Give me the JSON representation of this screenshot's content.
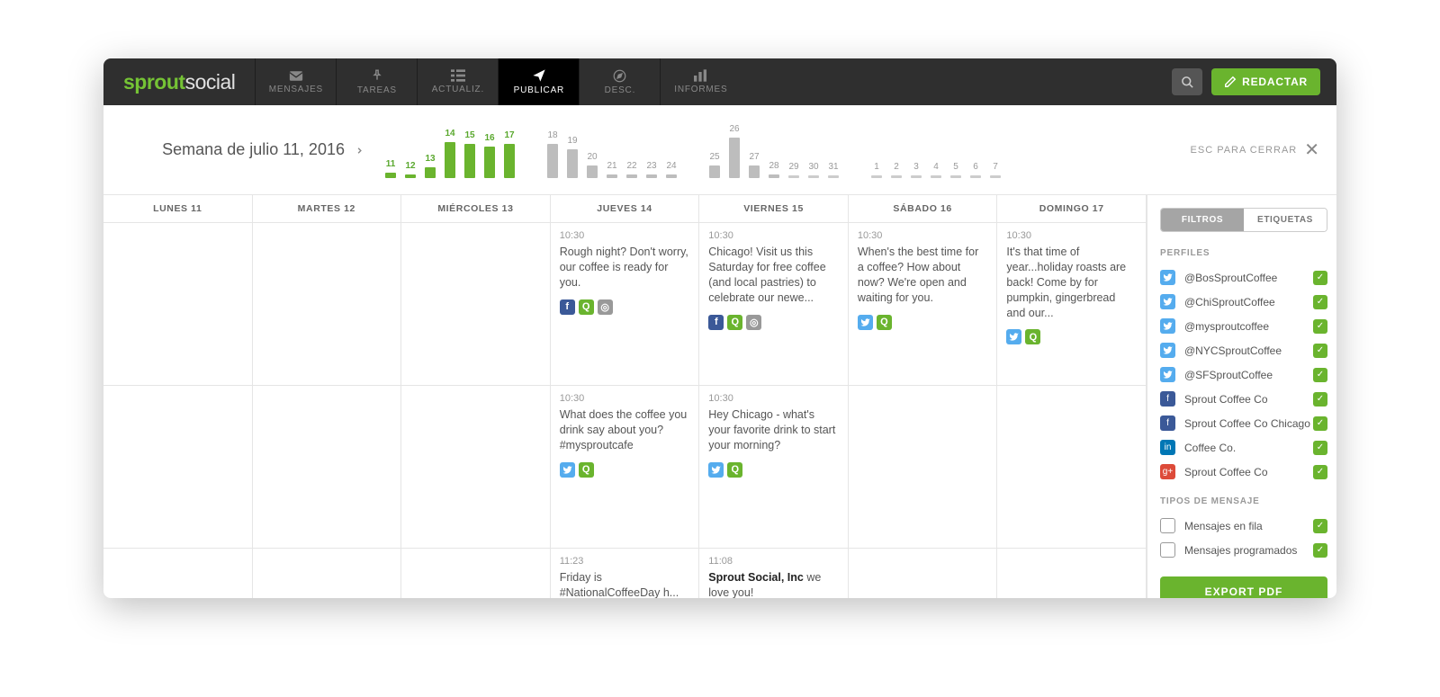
{
  "brand": {
    "part1": "sprout",
    "part2": "social"
  },
  "nav": [
    {
      "label": "MENSAJES",
      "icon": "mail"
    },
    {
      "label": "TAREAS",
      "icon": "pin"
    },
    {
      "label": "ACTUALIZ.",
      "icon": "feed"
    },
    {
      "label": "PUBLICAR",
      "icon": "send",
      "active": true
    },
    {
      "label": "DESC.",
      "icon": "compass"
    },
    {
      "label": "INFORMES",
      "icon": "bars"
    }
  ],
  "compose_label": "REDACTAR",
  "week_title": "Semana de julio 11, 2016",
  "close_label": "ESC PARA CERRAR",
  "chart_data": {
    "type": "bar",
    "title": "",
    "xlabel": "",
    "ylabel": "",
    "ylim": [
      0,
      50
    ],
    "groups": [
      {
        "name": "current_week",
        "color": "#6ab42e",
        "categories": [
          "11",
          "12",
          "13",
          "14",
          "15",
          "16",
          "17"
        ],
        "values": [
          6,
          4,
          12,
          40,
          38,
          35,
          38
        ]
      },
      {
        "name": "next_week",
        "color": "#bdbdbd",
        "categories": [
          "18",
          "19",
          "20",
          "21",
          "22",
          "23",
          "24"
        ],
        "values": [
          38,
          32,
          14,
          4,
          4,
          4,
          4
        ]
      },
      {
        "name": "week_after",
        "color": "#bdbdbd",
        "categories": [
          "25",
          "26",
          "27",
          "28",
          "29",
          "30",
          "31"
        ],
        "values": [
          14,
          45,
          14,
          4,
          3,
          3,
          3
        ]
      },
      {
        "name": "future",
        "color": "#cccccc",
        "categories": [
          "1",
          "2",
          "3",
          "4",
          "5",
          "6",
          "7"
        ],
        "values": [
          2,
          2,
          2,
          2,
          2,
          2,
          2
        ]
      }
    ]
  },
  "day_headers": [
    "LUNES 11",
    "MARTES 12",
    "MIÉRCOLES 13",
    "JUEVES 14",
    "VIERNES 15",
    "SÁBADO 16",
    "DOMINGO 17"
  ],
  "rows": [
    {
      "cells": [
        null,
        null,
        null,
        {
          "time": "10:30",
          "msg": "Rough night? Don't worry, our coffee is ready for you.",
          "icons": [
            "fb",
            "qq",
            "ig"
          ]
        },
        {
          "time": "10:30",
          "msg": "Chicago! Visit us this Saturday for free coffee (and local pastries) to celebrate our newe...",
          "icons": [
            "fb",
            "qq",
            "ig"
          ]
        },
        {
          "time": "10:30",
          "msg": "When's the best time for a coffee? How about now? We're open and waiting for you.",
          "icons": [
            "tw",
            "qq"
          ]
        },
        {
          "time": "10:30",
          "msg": "It's that time of year...holiday roasts are back! Come by for pumpkin, gingerbread and our...",
          "icons": [
            "tw",
            "qq"
          ]
        }
      ]
    },
    {
      "cells": [
        null,
        null,
        null,
        {
          "time": "10:30",
          "msg": "What does the coffee you drink say about you? #mysproutcafe",
          "icons": [
            "tw",
            "qq"
          ]
        },
        {
          "time": "10:30",
          "msg": "Hey Chicago - what's your favorite drink to start your morning?",
          "icons": [
            "tw",
            "qq"
          ]
        },
        null,
        null
      ]
    },
    {
      "short": true,
      "cells": [
        null,
        null,
        null,
        {
          "time": "11:23",
          "msg": "Friday is #NationalCoffeeDay h...",
          "icons": []
        },
        {
          "time": "11:08",
          "msg_html": "<b>Sprout Social, Inc</b> we love you!",
          "icons": []
        },
        null,
        null
      ]
    }
  ],
  "sidebar": {
    "tabs": {
      "filtros": "FILTROS",
      "etiquetas": "ETIQUETAS"
    },
    "profiles_h": "PERFILES",
    "profiles": [
      {
        "nw": "tw",
        "label": "@BosSproutCoffee"
      },
      {
        "nw": "tw",
        "label": "@ChiSproutCoffee"
      },
      {
        "nw": "tw",
        "label": "@mysproutcoffee"
      },
      {
        "nw": "tw",
        "label": "@NYCSproutCoffee"
      },
      {
        "nw": "tw",
        "label": "@SFSproutCoffee"
      },
      {
        "nw": "fb",
        "label": "Sprout Coffee Co"
      },
      {
        "nw": "fb",
        "label": "Sprout Coffee Co Chicago"
      },
      {
        "nw": "li",
        "label": "Coffee Co."
      },
      {
        "nw": "gp",
        "label": "Sprout Coffee Co"
      }
    ],
    "types_h": "TIPOS DE MENSAJE",
    "types": [
      {
        "nw": "q",
        "label": "Mensajes en fila"
      },
      {
        "nw": "cal",
        "label": "Mensajes programados"
      }
    ],
    "export": "EXPORT PDF"
  }
}
